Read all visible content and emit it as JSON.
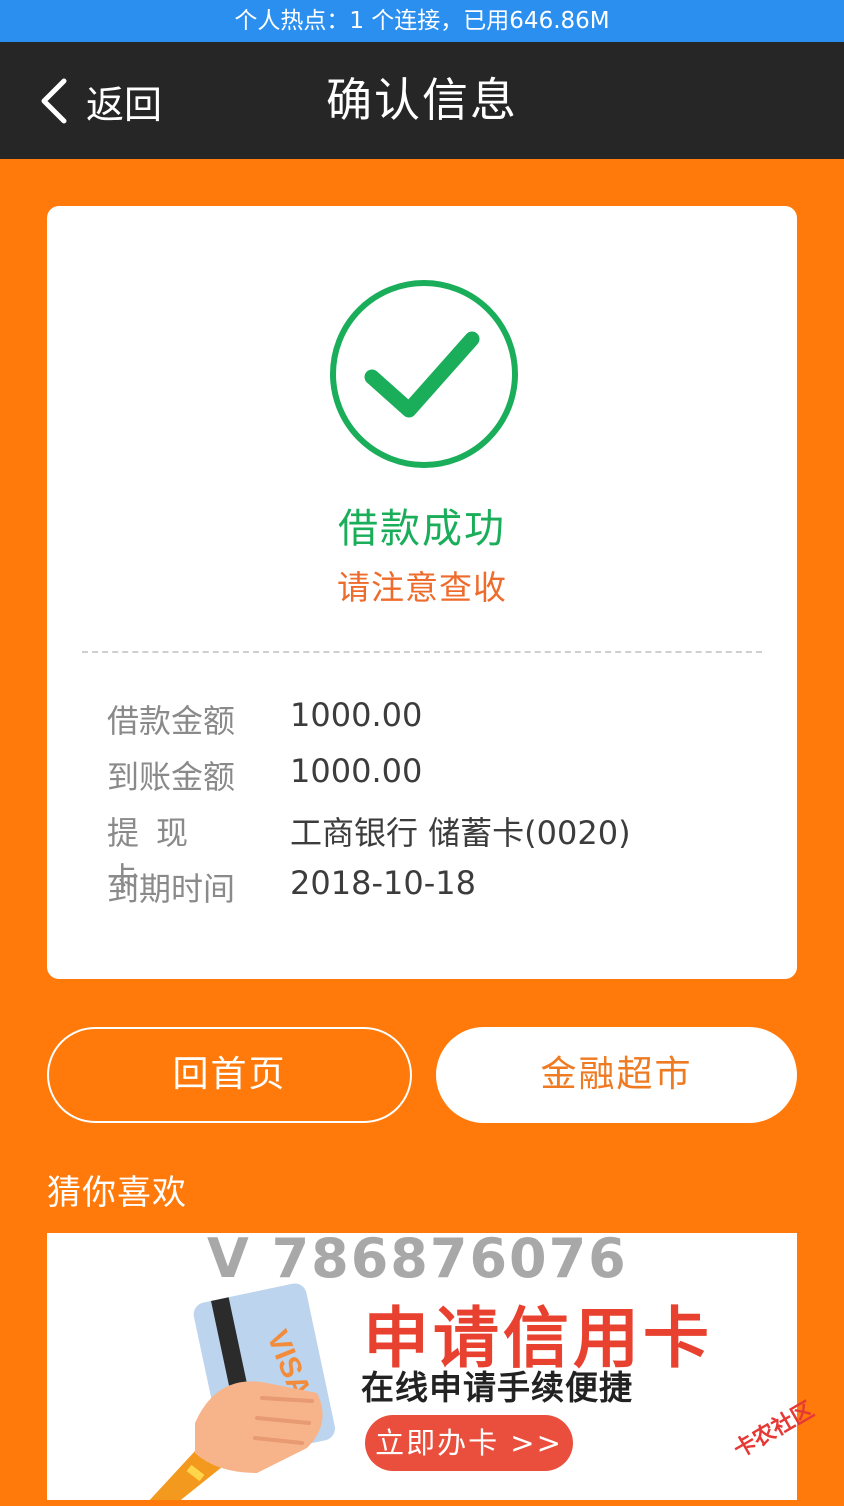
{
  "status_bar": {
    "text": "个人热点：1 个连接，已用646.86M"
  },
  "nav": {
    "back_label": "返回",
    "title": "确认信息"
  },
  "result": {
    "title": "借款成功",
    "subtitle": "请注意查收"
  },
  "details": [
    {
      "label": "借款金额",
      "value": "1000.00"
    },
    {
      "label": "到账金额",
      "value": "1000.00"
    },
    {
      "label": "提现卡",
      "value": "工商银行 储蓄卡(0020)"
    },
    {
      "label": "到期时间",
      "value": "2018-10-18"
    }
  ],
  "buttons": {
    "home": "回首页",
    "market": "金融超市"
  },
  "recommend": {
    "title": "猜你喜欢",
    "banner": {
      "watermark": "V 786876076",
      "card_brand": "VISA",
      "title": "申请信用卡",
      "subtitle": "在线申请手续便捷",
      "cta": "立即办卡 >>"
    }
  },
  "corner_mark": "卡农社区",
  "colors": {
    "status_bar": "#2b8ff0",
    "nav_bar": "#262626",
    "background": "#ff7a0a",
    "success_green": "#1aad5a",
    "accent_orange": "#ee6b2c",
    "banner_red": "#e8412f"
  }
}
